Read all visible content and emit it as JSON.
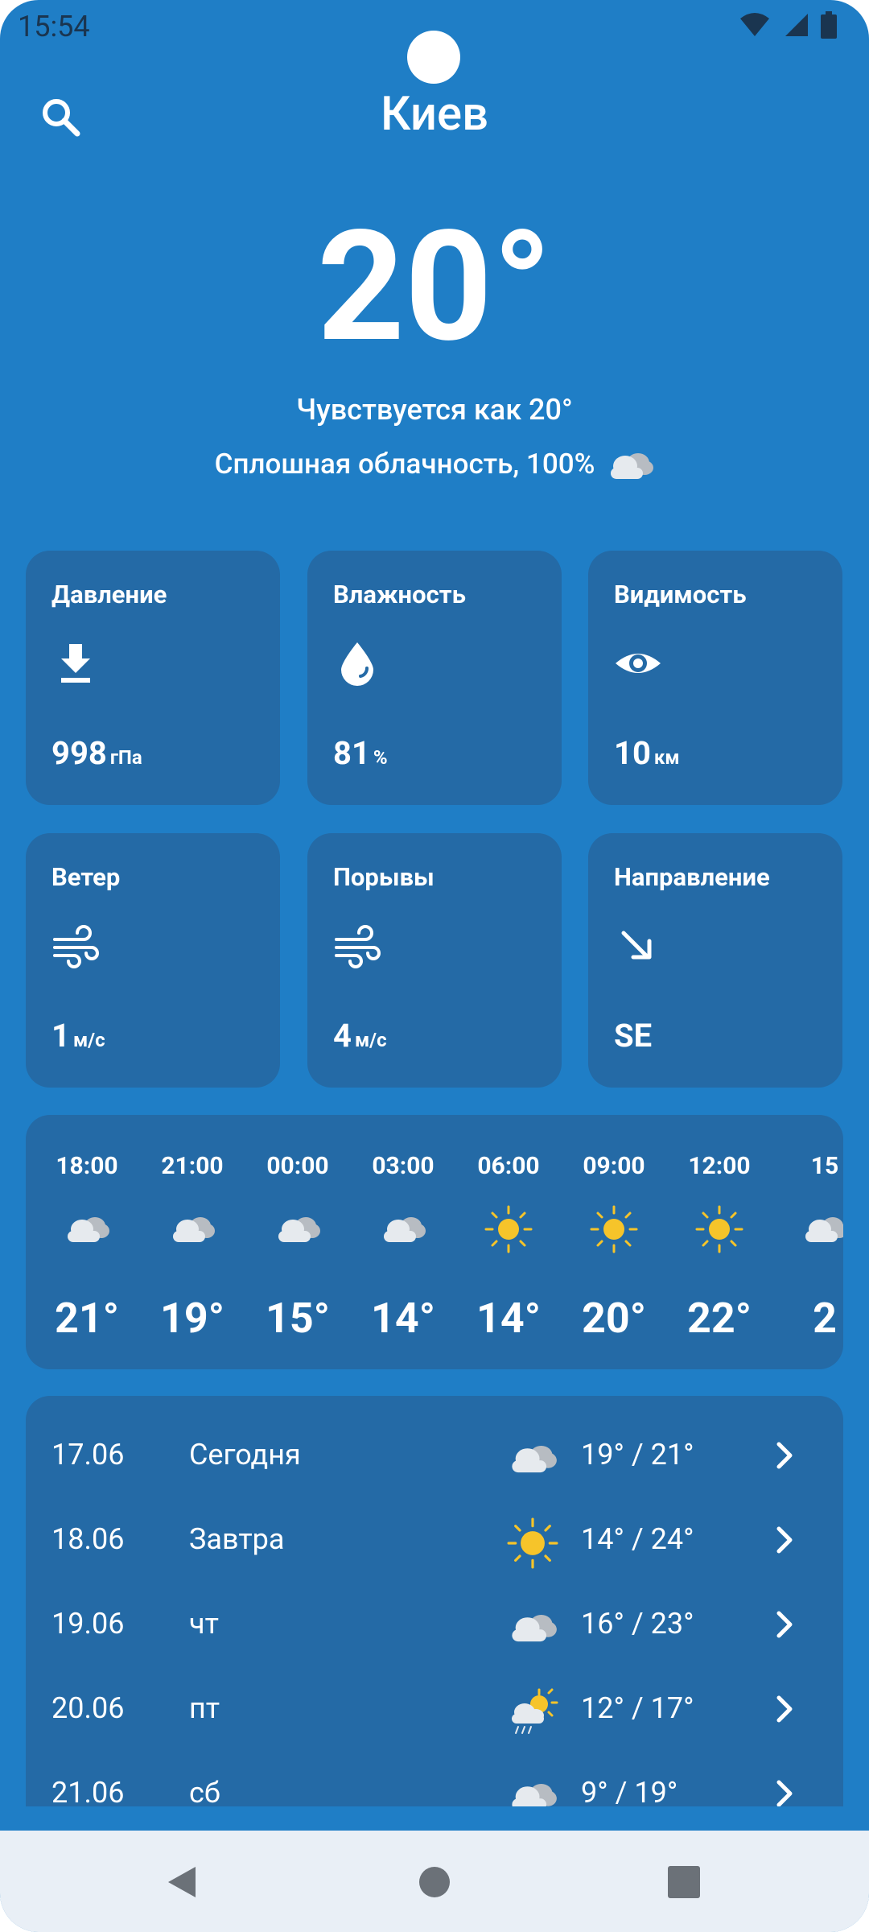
{
  "status": {
    "time": "15:54"
  },
  "header": {
    "city": "Киев",
    "search_icon": "search-icon"
  },
  "current": {
    "temperature": "20°",
    "feels_like": "Чувствуется как 20°",
    "condition": "Сплошная облачность, 100%",
    "condition_icon": "cloudy-icon"
  },
  "metrics": [
    {
      "label": "Давление",
      "icon": "pressure-icon",
      "value": "998",
      "unit": "гПа"
    },
    {
      "label": "Влажность",
      "icon": "humidity-icon",
      "value": "81",
      "unit": "%"
    },
    {
      "label": "Видимость",
      "icon": "visibility-icon",
      "value": "10",
      "unit": "км"
    },
    {
      "label": "Ветер",
      "icon": "wind-icon",
      "value": "1",
      "unit": "м/с"
    },
    {
      "label": "Порывы",
      "icon": "gusts-icon",
      "value": "4",
      "unit": "м/с"
    },
    {
      "label": "Направление",
      "icon": "direction-arrow-icon",
      "value": "SE",
      "unit": ""
    }
  ],
  "hourly": [
    {
      "time": "18:00",
      "icon": "cloudy",
      "temp": "21°"
    },
    {
      "time": "21:00",
      "icon": "cloudy",
      "temp": "19°"
    },
    {
      "time": "00:00",
      "icon": "cloudy",
      "temp": "15°"
    },
    {
      "time": "03:00",
      "icon": "cloudy",
      "temp": "14°"
    },
    {
      "time": "06:00",
      "icon": "sunny",
      "temp": "14°"
    },
    {
      "time": "09:00",
      "icon": "sunny",
      "temp": "20°"
    },
    {
      "time": "12:00",
      "icon": "sunny",
      "temp": "22°"
    },
    {
      "time": "15",
      "icon": "cloudy",
      "temp": "2"
    }
  ],
  "daily": [
    {
      "date": "17.06",
      "name": "Сегодня",
      "icon": "cloudy",
      "temps": "19° / 21°"
    },
    {
      "date": "18.06",
      "name": "Завтра",
      "icon": "sunny",
      "temps": "14° / 24°"
    },
    {
      "date": "19.06",
      "name": "чт",
      "icon": "cloudy",
      "temps": "16° / 23°"
    },
    {
      "date": "20.06",
      "name": "пт",
      "icon": "sun-rain",
      "temps": "12° / 17°"
    },
    {
      "date": "21.06",
      "name": "сб",
      "icon": "cloudy",
      "temps": "9° / 19°"
    }
  ],
  "colors": {
    "background": "#1f7ec6",
    "card": "#246aa6",
    "sun": "#f6c42a",
    "cloud": "#e6eaee"
  }
}
